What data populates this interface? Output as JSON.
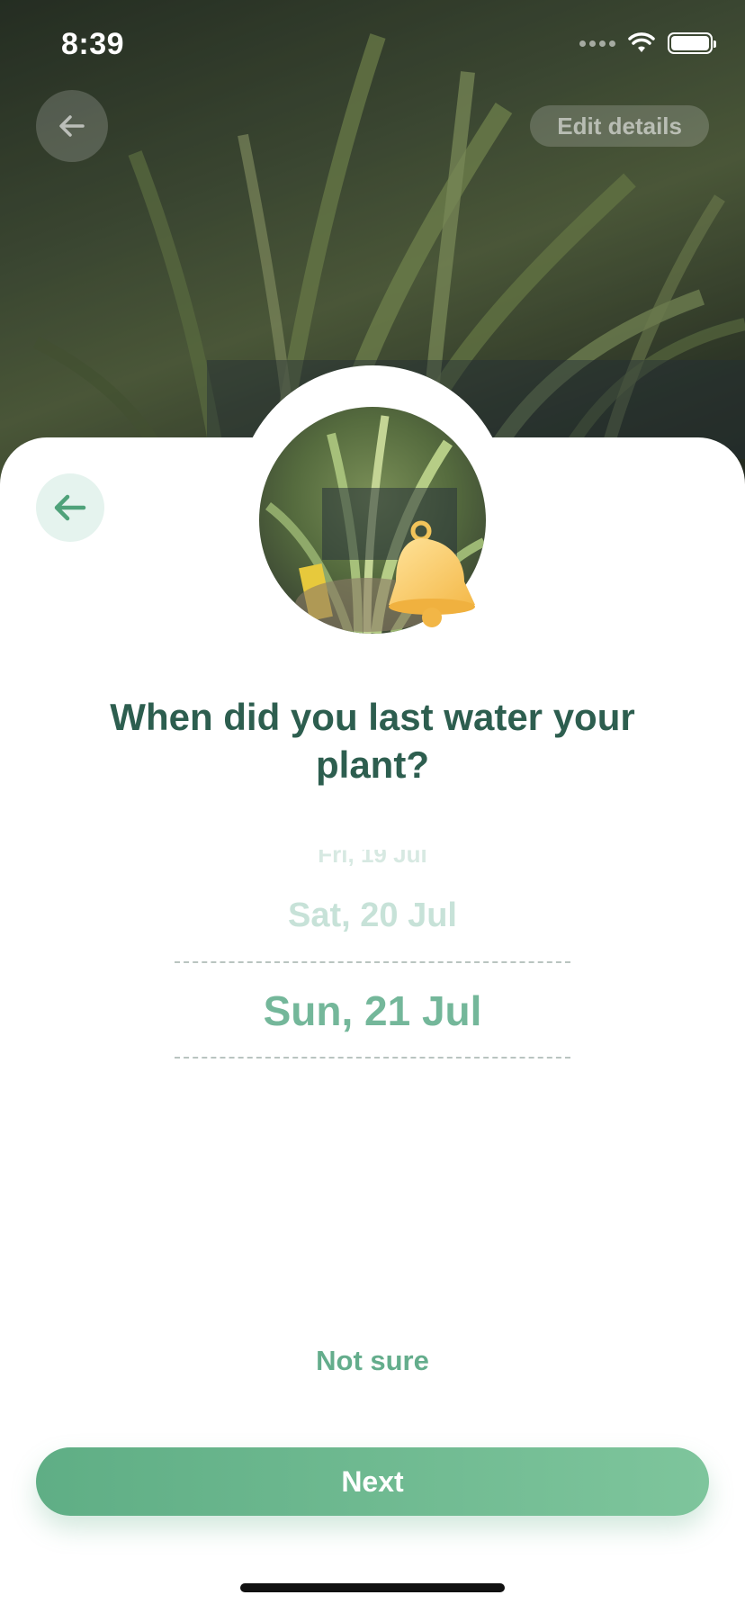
{
  "status_bar": {
    "time": "8:39",
    "icons": [
      "signal-dots-icon",
      "wifi-icon",
      "battery-icon"
    ]
  },
  "header": {
    "back_icon": "arrow-left-icon",
    "edit_details_label": "Edit details"
  },
  "sheet": {
    "back_icon": "arrow-left-icon",
    "plant_photo": "plant-photo",
    "badge_icon": "bell-icon",
    "question": "When did you last water your plant?"
  },
  "date_picker": {
    "items": [
      "Fri, 19 Jul",
      "Sat, 20 Jul",
      "Sun, 21 Jul"
    ],
    "selected": "Sun, 21 Jul"
  },
  "actions": {
    "not_sure_label": "Not sure",
    "next_label": "Next"
  },
  "colors": {
    "primary_green": "#5fae85",
    "heading_green": "#2d5e4f",
    "selected_date": "#74b79a",
    "back_button_bg": "#e5f3ee"
  }
}
